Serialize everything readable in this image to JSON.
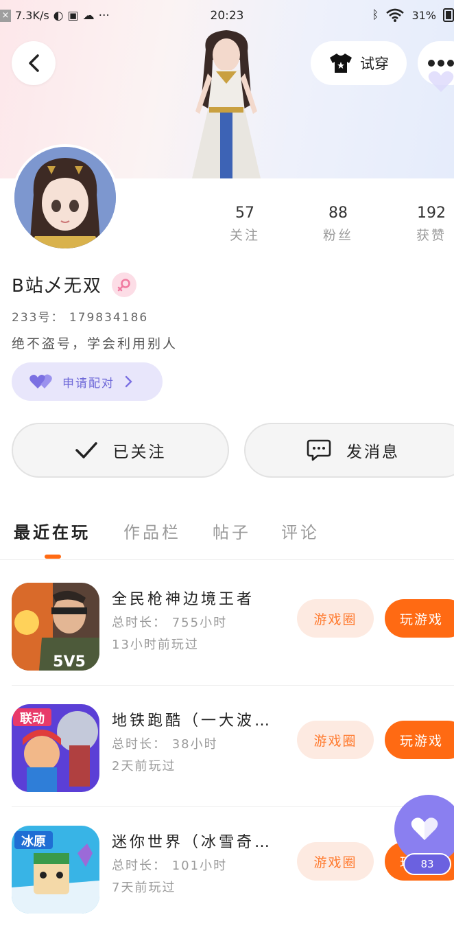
{
  "status_bar": {
    "speed": "7.3K/s",
    "time": "20:23",
    "battery": "31%"
  },
  "header": {
    "tryon_label": "试穿"
  },
  "profile": {
    "name": "B站乄无双",
    "uid": "233号： 179834186",
    "bio": "绝不盗号，学会利用别人",
    "pair_label": "申请配对",
    "stats": [
      {
        "value": "57",
        "label": "关注"
      },
      {
        "value": "88",
        "label": "粉丝"
      },
      {
        "value": "192",
        "label": "获赞"
      }
    ]
  },
  "actions": {
    "follow_label": "已关注",
    "message_label": "发消息"
  },
  "tabs": [
    {
      "label": "最近在玩",
      "active": true
    },
    {
      "label": "作品栏",
      "active": false
    },
    {
      "label": "帖子",
      "active": false
    },
    {
      "label": "评论",
      "active": false
    }
  ],
  "games": [
    {
      "title": "全民枪神边境王者",
      "play_time": "总时长： 755小时",
      "last_played": "13小时前玩过",
      "circle_label": "游戏圈",
      "play_label": "玩游戏",
      "icon_text": "5V5"
    },
    {
      "title": "地铁跑酷（一大波…",
      "play_time": "总时长： 38小时",
      "last_played": "2天前玩过",
      "circle_label": "游戏圈",
      "play_label": "玩游戏",
      "icon_text": "联动"
    },
    {
      "title": "迷你世界（冰雪奇…",
      "play_time": "总时长： 101小时",
      "last_played": "7天前玩过",
      "circle_label": "游戏圈",
      "play_label": "玩游戏",
      "icon_text": "冰原"
    }
  ],
  "like_fab": {
    "count": "83"
  },
  "colors": {
    "accent_orange": "#ff6a13",
    "accent_purple": "#8a7ff0",
    "female_pink": "#f07aa0"
  }
}
